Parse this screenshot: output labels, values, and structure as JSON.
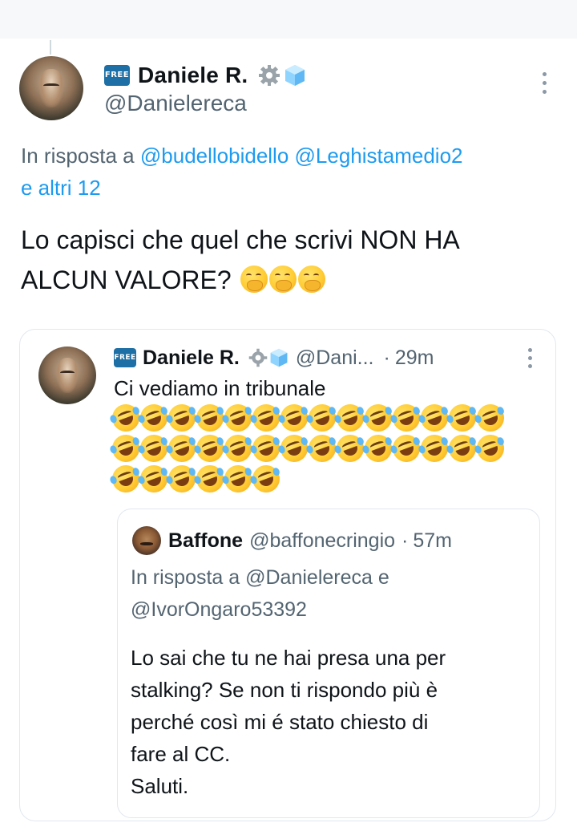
{
  "tweet": {
    "badge": "FREE",
    "display_name": "Daniele R.",
    "handle": "@Danielereca",
    "reply_prefix": "In risposta a",
    "reply_mention_1": "@budellobidello",
    "reply_mention_2": "@Leghistamedio2",
    "reply_others": "e altri 12",
    "text": "Lo capisci che quel che scrivi NON HA ALCUN VALORE?",
    "emoji_count": 3
  },
  "quoted": {
    "badge": "FREE",
    "display_name": "Daniele R.",
    "handle": "@Dani...",
    "separator": "·",
    "time": "29m",
    "text": "Ci vediamo in tribunale",
    "laugh_rows": [
      14,
      14,
      6
    ]
  },
  "inner": {
    "display_name": "Baffone",
    "handle": "@baffonecringio",
    "separator": "·",
    "time": "57m",
    "reply_line_1": "In risposta a @Danielereca e",
    "reply_line_2": "@IvorOngaro53392",
    "text_lines": [
      "Lo sai che tu ne hai presa una per",
      "stalking? Se non ti rispondo più è",
      "perché così mi é stato chiesto di",
      "fare al CC.",
      "Saluti."
    ]
  }
}
